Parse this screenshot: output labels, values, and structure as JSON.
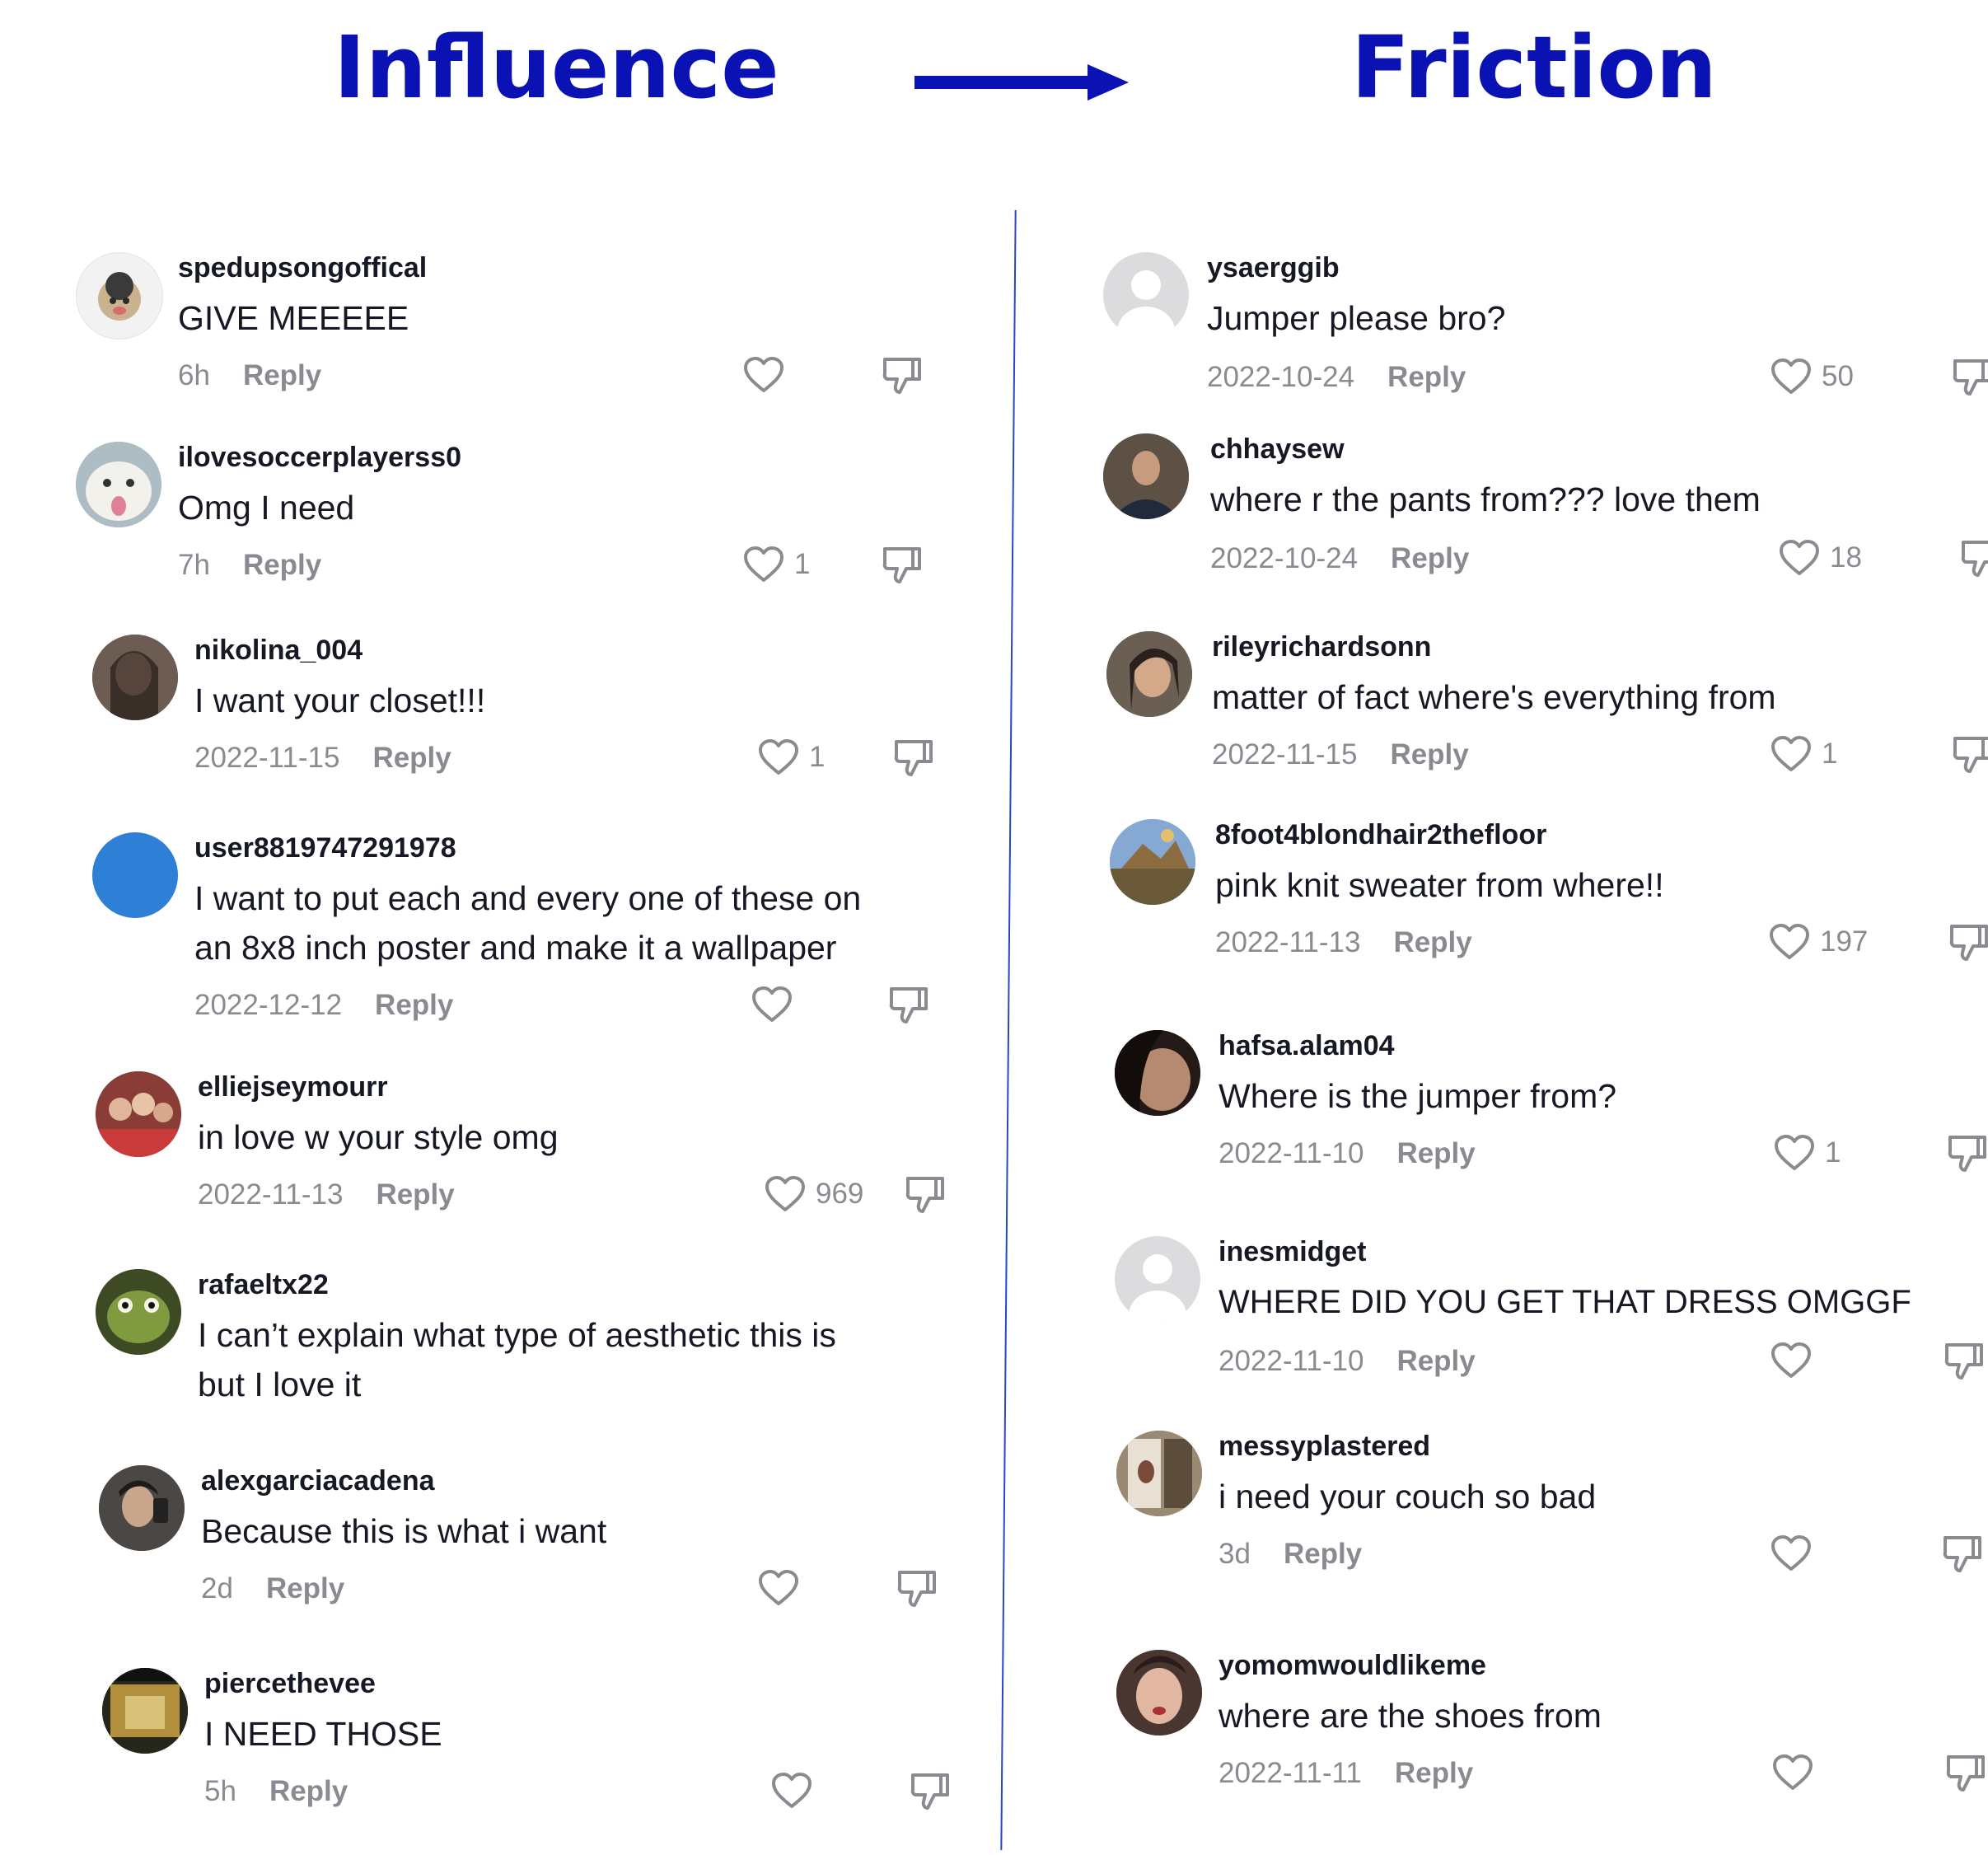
{
  "header": {
    "left_title": "Influence",
    "right_title": "Friction",
    "accent_color": "#0a12b4"
  },
  "left_comments": [
    {
      "username": "spedupsongoffical",
      "text": "GIVE MEEEEE",
      "time": "6h",
      "reply": "Reply",
      "likes": "",
      "avatar": "sticker-avatar"
    },
    {
      "username": "ilovesoccerplayerss0",
      "text": "Omg I need",
      "time": "7h",
      "reply": "Reply",
      "likes": "1",
      "avatar": "cat-avatar"
    },
    {
      "username": "nikolina_004",
      "text": "I want your closet!!!",
      "time": "2022-11-15",
      "reply": "Reply",
      "likes": "1",
      "avatar": "photo-avatar"
    },
    {
      "username": "user8819747291978",
      "text": "I want to put each and every one of these on",
      "text2": "an 8x8 inch poster and make it a wallpaper",
      "time": "2022-12-12",
      "reply": "Reply",
      "likes": "",
      "avatar": "blue-avatar"
    },
    {
      "username": "elliejseymourr",
      "text": "in love w your style omg",
      "time": "2022-11-13",
      "reply": "Reply",
      "likes": "969",
      "avatar": "photo-avatar"
    },
    {
      "username": "rafaeltx22",
      "text": "I can’t explain what type of aesthetic this is",
      "text2": "but I love it",
      "time": "",
      "reply": "",
      "likes": "",
      "avatar": "turtle-avatar"
    },
    {
      "username": "alexgarciacadena",
      "text": "Because this is what i want",
      "time": "2d",
      "reply": "Reply",
      "likes": "",
      "avatar": "photo-avatar"
    },
    {
      "username": "piercethevee",
      "text": "I NEED THOSE",
      "time": "5h",
      "reply": "Reply",
      "likes": "",
      "avatar": "photo-avatar"
    }
  ],
  "right_comments": [
    {
      "username": "ysaerggib",
      "text": "Jumper please bro?",
      "time": "2022-10-24",
      "reply": "Reply",
      "likes": "50",
      "avatar": "default-avatar"
    },
    {
      "username": "chhaysew",
      "text": "where r the pants from??? love them",
      "time": "2022-10-24",
      "reply": "Reply",
      "likes": "18",
      "avatar": "photo-avatar"
    },
    {
      "username": "rileyrichardsonn",
      "text": "matter of fact where's everything from",
      "time": "2022-11-15",
      "reply": "Reply",
      "likes": "1",
      "avatar": "photo-avatar"
    },
    {
      "username": "8foot4blondhair2thefloor",
      "text": "pink knit sweater from where!!",
      "time": "2022-11-13",
      "reply": "Reply",
      "likes": "197",
      "avatar": "photo-avatar"
    },
    {
      "username": "hafsa.alam04",
      "text": "Where is the jumper from?",
      "time": "2022-11-10",
      "reply": "Reply",
      "likes": "1",
      "avatar": "photo-avatar"
    },
    {
      "username": "inesmidget",
      "text": "WHERE DID YOU GET THAT DRESS OMGGF",
      "time": "2022-11-10",
      "reply": "Reply",
      "likes": "",
      "avatar": "default-avatar"
    },
    {
      "username": "messyplastered",
      "text": "i need your couch so bad",
      "time": "3d",
      "reply": "Reply",
      "likes": "",
      "avatar": "photo-avatar"
    },
    {
      "username": "yomomwouldlikeme",
      "text": "where are the shoes from",
      "time": "2022-11-11",
      "reply": "Reply",
      "likes": "",
      "avatar": "photo-avatar"
    }
  ]
}
